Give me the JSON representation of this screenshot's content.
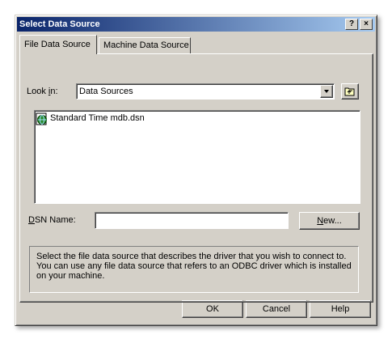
{
  "window": {
    "title": "Select Data Source",
    "help_button": "?",
    "close_button": "×"
  },
  "tabs": [
    {
      "label": "File Data Source",
      "active": true
    },
    {
      "label": "Machine Data Source",
      "active": false
    }
  ],
  "look_in": {
    "label_prefix": "Look ",
    "label_accel": "i",
    "label_suffix": "n:",
    "value": "Data Sources"
  },
  "file_list": [
    {
      "name": "Standard Time mdb.dsn",
      "icon": "dsn-file-icon"
    }
  ],
  "dsn_name": {
    "label_accel": "D",
    "label_rest": "SN Name:",
    "value": ""
  },
  "new_button": {
    "accel": "N",
    "rest": "ew..."
  },
  "description": "Select the file data source that describes the driver that you wish to connect to. You can use any file data source that refers to an ODBC driver which is installed on your machine.",
  "buttons": {
    "ok": "OK",
    "cancel": "Cancel",
    "help": "Help"
  }
}
